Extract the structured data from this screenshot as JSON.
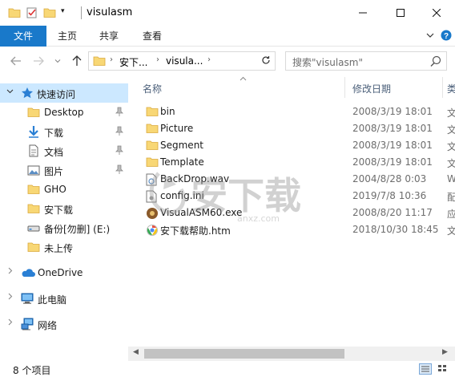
{
  "window": {
    "title": "visulasm",
    "quick_access_icons": [
      "folder-icon",
      "properties-icon",
      "new-folder-icon",
      "dropdown-icon"
    ],
    "buttons": [
      "minimize-icon",
      "maximize-icon",
      "close-icon"
    ]
  },
  "ribbon": {
    "tabs": [
      {
        "label": "文件"
      },
      {
        "label": "主页"
      },
      {
        "label": "共享"
      },
      {
        "label": "查看"
      }
    ],
    "accent": "#1979ca"
  },
  "address": {
    "crumbs": [
      "安下...",
      "visula..."
    ],
    "search_placeholder": "搜索\"visulasm\""
  },
  "nav": {
    "quick_access": {
      "label": "快速访问"
    },
    "items": [
      {
        "label": "Desktop",
        "icon": "folder-icon",
        "pinned": true
      },
      {
        "label": "下载",
        "icon": "download-arrow-icon",
        "pinned": true
      },
      {
        "label": "文档",
        "icon": "document-icon",
        "pinned": true
      },
      {
        "label": "图片",
        "icon": "picture-icon",
        "pinned": true
      },
      {
        "label": "GHO",
        "icon": "folder-icon",
        "pinned": false
      },
      {
        "label": "安下载",
        "icon": "folder-icon",
        "pinned": false
      },
      {
        "label": "备份[勿删] (E:)",
        "icon": "drive-icon",
        "pinned": false
      },
      {
        "label": "未上传",
        "icon": "folder-icon",
        "pinned": false
      }
    ],
    "onedrive": {
      "label": "OneDrive"
    },
    "this_pc": {
      "label": "此电脑"
    },
    "network": {
      "label": "网络"
    }
  },
  "files": {
    "columns": [
      {
        "label": "名称"
      },
      {
        "label": "修改日期"
      },
      {
        "label": "类"
      }
    ],
    "rows": [
      {
        "name": "bin",
        "date": "2008/3/19 18:01",
        "type": "文",
        "icon": "folder-icon"
      },
      {
        "name": "Picture",
        "date": "2008/3/19 18:01",
        "type": "文",
        "icon": "folder-icon"
      },
      {
        "name": "Segment",
        "date": "2008/3/19 18:01",
        "type": "文",
        "icon": "folder-icon"
      },
      {
        "name": "Template",
        "date": "2008/3/19 18:01",
        "type": "文",
        "icon": "folder-icon"
      },
      {
        "name": "BackDrop.wav",
        "date": "2004/8/28 0:03",
        "type": "W",
        "icon": "audio-file-icon"
      },
      {
        "name": "config.ini",
        "date": "2019/7/8 10:36",
        "type": "配",
        "icon": "settings-file-icon"
      },
      {
        "name": "VisualASM60.exe",
        "date": "2008/8/20 11:17",
        "type": "应",
        "icon": "exe-file-icon"
      },
      {
        "name": "安下载帮助.htm",
        "date": "2018/10/30 18:45",
        "type": "文",
        "icon": "html-file-icon"
      }
    ]
  },
  "status": {
    "item_count": "8 个项目"
  },
  "watermark": {
    "text": "安下载",
    "sub": "anxz.com"
  },
  "colors": {
    "folder": "#f8d775",
    "selected": "#cce8ff",
    "header_text": "#4c607a"
  }
}
